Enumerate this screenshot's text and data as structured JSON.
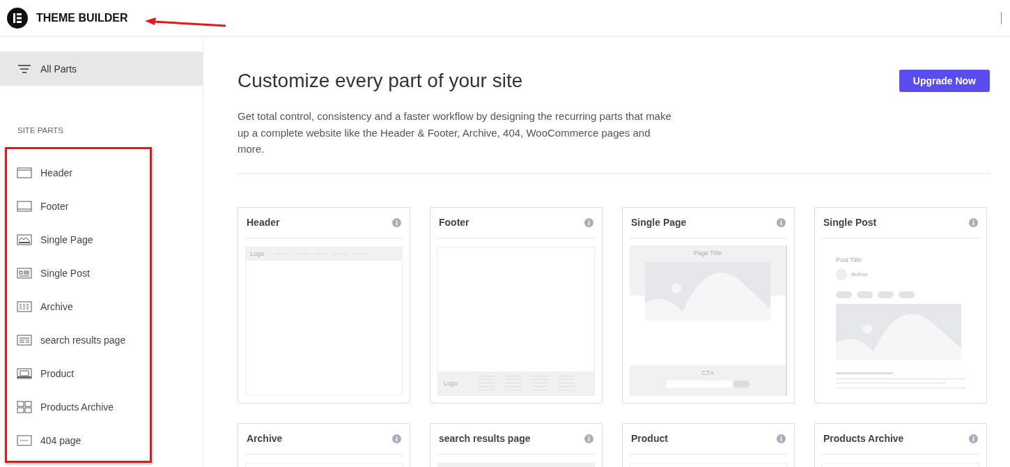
{
  "app_bar": {
    "title": "THEME BUILDER"
  },
  "sidebar": {
    "all_parts": {
      "label": "All Parts",
      "selected": true
    },
    "section_title": "SITE PARTS",
    "items": [
      {
        "kind": "header",
        "label": "Header"
      },
      {
        "kind": "footer",
        "label": "Footer"
      },
      {
        "kind": "single-page",
        "label": "Single Page"
      },
      {
        "kind": "single-post",
        "label": "Single Post"
      },
      {
        "kind": "archive",
        "label": "Archive"
      },
      {
        "kind": "search",
        "label": "search results page"
      },
      {
        "kind": "product",
        "label": "Product"
      },
      {
        "kind": "products-archive",
        "label": "Products Archive"
      },
      {
        "kind": "notfound",
        "label": "404 page"
      }
    ]
  },
  "main": {
    "heading": "Customize every part of your site",
    "upgrade_button": "Upgrade Now",
    "description": "Get total control, consistency and a faster workflow by designing the recurring parts that make up a complete website like the Header & Footer, Archive, 404, WooCommerce pages and more.",
    "cards": [
      {
        "kind": "header",
        "title": "Header",
        "preview_texts": [
          "Logo"
        ]
      },
      {
        "kind": "footer",
        "title": "Footer",
        "preview_texts": [
          "Logo"
        ]
      },
      {
        "kind": "single-page",
        "title": "Single Page",
        "preview_texts": [
          "Page Title",
          "CTA"
        ]
      },
      {
        "kind": "single-post",
        "title": "Single Post",
        "preview_texts": [
          "Post Title",
          "Author"
        ]
      },
      {
        "kind": "archive",
        "title": "Archive"
      },
      {
        "kind": "search",
        "title": "search results page"
      },
      {
        "kind": "product",
        "title": "Product"
      },
      {
        "kind": "products-archive",
        "title": "Products Archive"
      }
    ]
  }
}
